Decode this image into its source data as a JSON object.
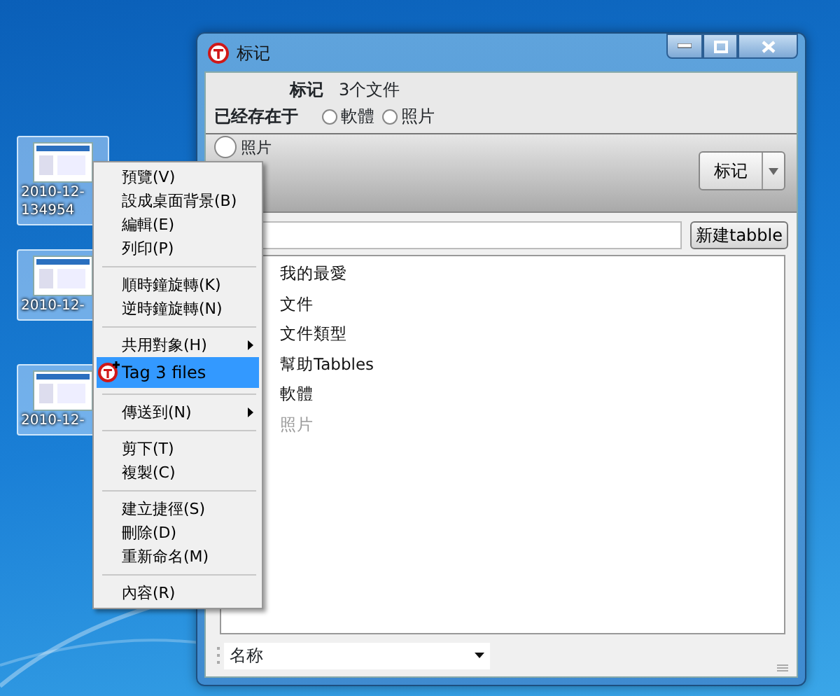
{
  "desktop_icons": [
    {
      "label_lines": [
        "2010-12-",
        "134954"
      ],
      "selected": true
    },
    {
      "label_lines": [
        "2010-12-"
      ],
      "selected": true
    },
    {
      "label_lines": [
        "2010-12-"
      ],
      "selected": true
    }
  ],
  "window": {
    "title": "标记",
    "header": {
      "label": "标记",
      "value": "3个文件"
    },
    "exists_in": {
      "label": "已经存在于",
      "options": [
        {
          "label": "軟體",
          "checked": false
        },
        {
          "label": "照片",
          "checked": false
        }
      ]
    },
    "band_radio": {
      "label": "照片",
      "checked": false
    },
    "tag_button": {
      "label": "标记"
    },
    "new_tag_button": {
      "label": "新建tabble"
    },
    "tags": [
      {
        "label": "我的最愛",
        "disabled": false
      },
      {
        "label": "文件",
        "disabled": false
      },
      {
        "label": "文件類型",
        "disabled": false
      },
      {
        "label": "幫助Tabbles",
        "disabled": false
      },
      {
        "label": "軟體",
        "disabled": false
      },
      {
        "label": "照片",
        "disabled": true
      }
    ],
    "sort_field": {
      "value": "名称"
    }
  },
  "context_menu": [
    {
      "kind": "item",
      "label": "預覽(V)",
      "selected": false
    },
    {
      "kind": "item",
      "label": "設成桌面背景(B)",
      "selected": false
    },
    {
      "kind": "item",
      "label": "編輯(E)",
      "selected": false
    },
    {
      "kind": "item",
      "label": "列印(P)",
      "selected": false
    },
    {
      "kind": "separator"
    },
    {
      "kind": "item",
      "label": "順時鐘旋轉(K)",
      "selected": false
    },
    {
      "kind": "item",
      "label": "逆時鐘旋轉(N)",
      "selected": false
    },
    {
      "kind": "separator"
    },
    {
      "kind": "submenu",
      "label": "共用對象(H)",
      "selected": false
    },
    {
      "kind": "app",
      "label": "Tag 3 files",
      "selected": true
    },
    {
      "kind": "separator"
    },
    {
      "kind": "submenu",
      "label": "傳送到(N)",
      "selected": false
    },
    {
      "kind": "separator"
    },
    {
      "kind": "item",
      "label": "剪下(T)",
      "selected": false
    },
    {
      "kind": "item",
      "label": "複製(C)",
      "selected": false
    },
    {
      "kind": "separator"
    },
    {
      "kind": "item",
      "label": "建立捷徑(S)",
      "selected": false
    },
    {
      "kind": "item",
      "label": "刪除(D)",
      "selected": false
    },
    {
      "kind": "item",
      "label": "重新命名(M)",
      "selected": false
    },
    {
      "kind": "separator"
    },
    {
      "kind": "item",
      "label": "內容(R)",
      "selected": false
    }
  ]
}
